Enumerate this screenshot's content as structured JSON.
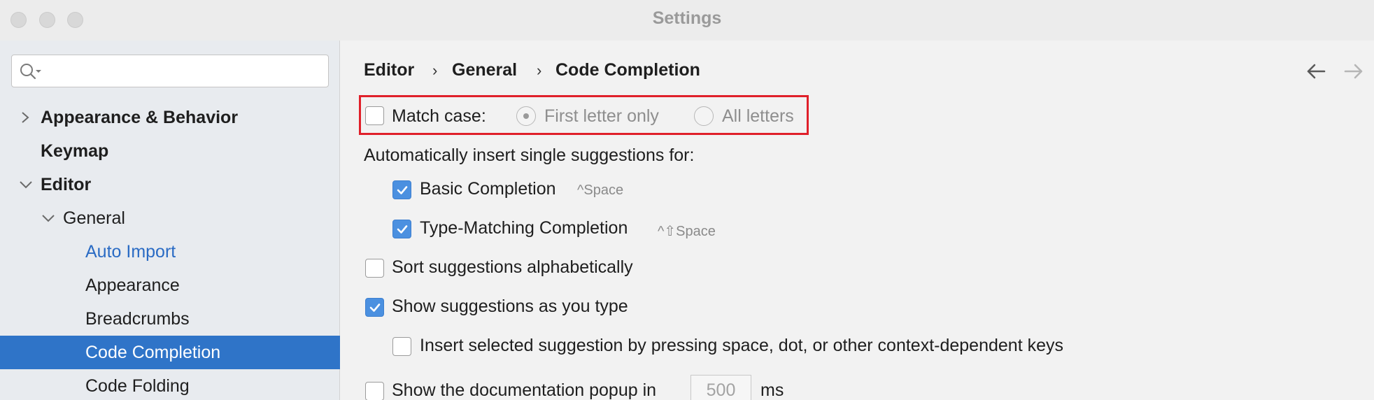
{
  "window": {
    "title": "Settings"
  },
  "sidebar": {
    "search": {
      "placeholder": ""
    },
    "tree": [
      {
        "label": "Appearance & Behavior",
        "bold": true,
        "expander": "chevron-right"
      },
      {
        "label": "Keymap",
        "bold": true
      },
      {
        "label": "Editor",
        "bold": true,
        "expander": "chevron-down"
      },
      {
        "label": "General",
        "bold": false,
        "expander": "chevron-down"
      },
      {
        "label": "Auto Import",
        "link": true
      },
      {
        "label": "Appearance"
      },
      {
        "label": "Breadcrumbs"
      },
      {
        "label": "Code Completion",
        "selected": true
      },
      {
        "label": "Code Folding"
      }
    ]
  },
  "breadcrumb": [
    "Editor",
    "General",
    "Code Completion"
  ],
  "breadcrumb_separator": "›",
  "options": {
    "match_case": {
      "label": "Match case:",
      "checked": false,
      "radio_first": "First letter only",
      "radio_all": "All letters",
      "selected": "First letter only",
      "disabled": true
    },
    "auto_insert_heading": "Automatically insert single suggestions for:",
    "basic_completion": {
      "label": "Basic Completion",
      "checked": true,
      "shortcut": "^Space"
    },
    "type_matching": {
      "label": "Type-Matching Completion",
      "checked": true,
      "shortcut": "^⇧Space"
    },
    "sort_alpha": {
      "label": "Sort suggestions alphabetically",
      "checked": false
    },
    "show_as_type": {
      "label": "Show suggestions as you type",
      "checked": true
    },
    "insert_selected": {
      "label": "Insert selected suggestion by pressing space, dot, or other context-dependent keys",
      "checked": false
    },
    "doc_popup": {
      "label": "Show the documentation popup in",
      "value": "500",
      "unit": "ms",
      "checked": false
    }
  },
  "colors": {
    "accent": "#2f74c8",
    "checkbox": "#4b90e0",
    "highlight": "#e0202a",
    "link": "#2a6bc4"
  }
}
